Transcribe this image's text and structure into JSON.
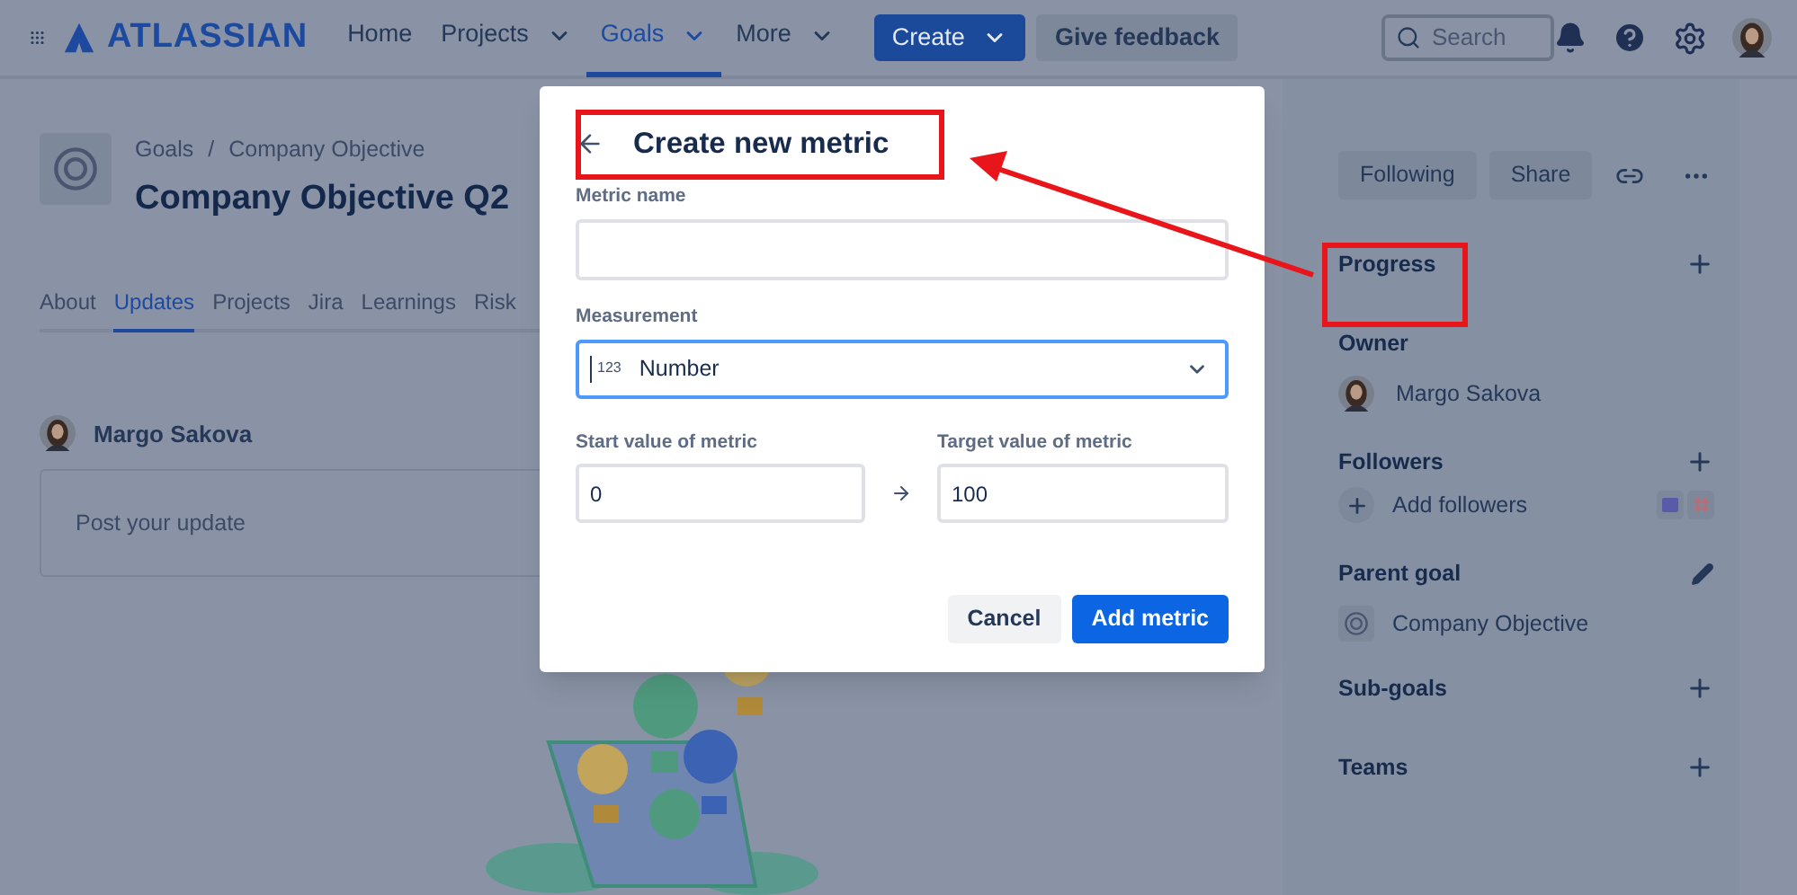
{
  "nav": {
    "logo": "ATLASSIAN",
    "items": [
      {
        "label": "Home",
        "selected": false,
        "dropdown": false
      },
      {
        "label": "Projects",
        "selected": false,
        "dropdown": true
      },
      {
        "label": "Goals",
        "selected": true,
        "dropdown": true
      },
      {
        "label": "More",
        "selected": false,
        "dropdown": true
      }
    ],
    "create": "Create",
    "feedback": "Give feedback",
    "search": {
      "placeholder": "Search"
    }
  },
  "goal": {
    "breadcrumb": [
      "Goals",
      "Company Objective"
    ],
    "separator": "/",
    "title": "Company Objective Q2"
  },
  "tabs": [
    {
      "label": "About",
      "selected": false
    },
    {
      "label": "Updates",
      "selected": true
    },
    {
      "label": "Projects",
      "selected": false
    },
    {
      "label": "Jira",
      "selected": false
    },
    {
      "label": "Learnings",
      "selected": false
    },
    {
      "label": "Risk",
      "selected": false
    }
  ],
  "update": {
    "author": "Margo Sakova",
    "placeholder": "Post your update"
  },
  "sidebar": {
    "buttons": [
      "Following",
      "Share"
    ],
    "sections": [
      {
        "title": "Progress",
        "kind": "add"
      },
      {
        "title": "Owner",
        "kind": "plain",
        "person": "Margo Sakova"
      },
      {
        "title": "Followers",
        "kind": "add",
        "add_label": "Add followers"
      },
      {
        "title": "Parent goal",
        "kind": "edit",
        "goal": "Company Objective"
      },
      {
        "title": "Sub-goals",
        "kind": "add"
      },
      {
        "title": "Teams",
        "kind": "add"
      }
    ]
  },
  "modal": {
    "title": "Create new metric",
    "metric_name": {
      "label": "Metric name"
    },
    "measurement": {
      "label": "Measurement",
      "badge": "123",
      "value": "Number"
    },
    "start": {
      "label": "Start value of metric",
      "value": "0"
    },
    "target": {
      "label": "Target value of metric",
      "value": "100"
    },
    "buttons": [
      {
        "label": "Cancel",
        "kind": "secondary"
      },
      {
        "label": "Add metric",
        "kind": "primary"
      }
    ]
  }
}
